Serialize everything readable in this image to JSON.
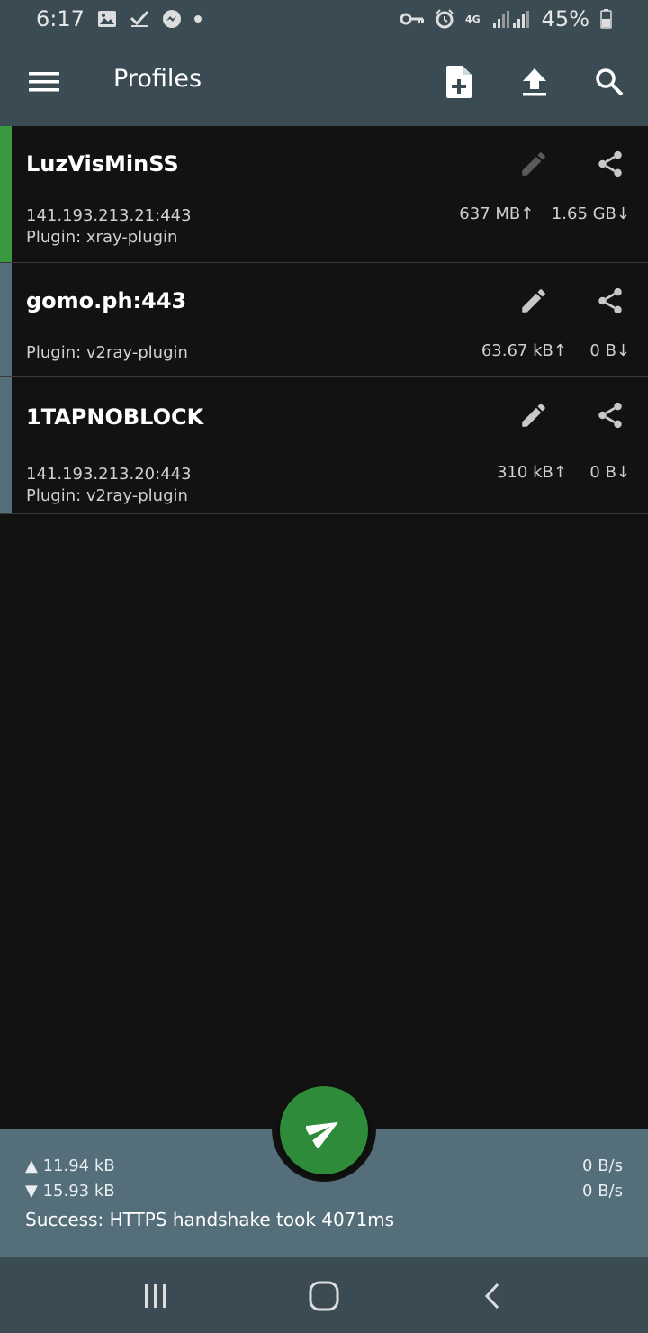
{
  "status_bar": {
    "time": "6:17",
    "network": "4G",
    "battery": "45%",
    "left_icons": [
      "gallery-icon",
      "check-icon",
      "messenger-icon"
    ],
    "right_icons": [
      "vpn-key-icon",
      "alarm-icon",
      "signal-icon",
      "battery-icon"
    ]
  },
  "toolbar": {
    "title": "Profiles",
    "icons": [
      "menu-icon",
      "add-file-icon",
      "upload-icon",
      "search-icon"
    ]
  },
  "profiles": [
    {
      "name": "LuzVisMinSS",
      "server": "141.193.213.21:443",
      "plugin": "Plugin: xray-plugin",
      "tx": "637 MB↑",
      "rx": "1.65 GB↓",
      "selected": true,
      "accent": "#3a9a3f",
      "edit_enabled": false
    },
    {
      "name": "gomo.ph:443",
      "server": "",
      "plugin": "Plugin: v2ray-plugin",
      "tx": "63.67 kB↑",
      "rx": "0 B↓",
      "selected": false,
      "accent": "#546e7a",
      "edit_enabled": true
    },
    {
      "name": "1TAPNOBLOCK",
      "server": "141.193.213.20:443",
      "plugin": "Plugin: v2ray-plugin",
      "tx": "310 kB↑",
      "rx": "0 B↓",
      "selected": false,
      "accent": "#546e7a",
      "edit_enabled": true
    }
  ],
  "stats": {
    "uploaded": "▲ 11.94 kB",
    "downloaded": "▼ 15.93 kB",
    "up_rate": "0 B/s",
    "down_rate": "0 B/s",
    "message": "Success: HTTPS handshake took 4071ms"
  },
  "fab": {
    "icon": "paper-plane-icon",
    "color": "#2e8b3a"
  },
  "nav": {
    "icons": [
      "recent-apps-icon",
      "home-icon",
      "back-icon"
    ]
  },
  "colors": {
    "bar": "#3b4b54",
    "panel": "#546e7a",
    "background": "#121212"
  }
}
